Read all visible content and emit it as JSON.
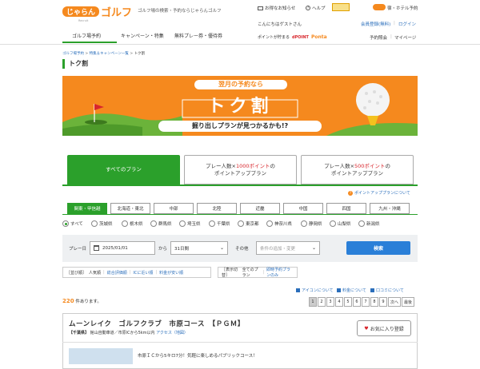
{
  "header": {
    "logo_text": "じゃらんゴルフ",
    "logo_sub": "Recruit",
    "tagline": "ゴルフ場の検索・予約ならじゃらんゴルフ",
    "mail": "お得なお知らせ",
    "help": "ヘルプ",
    "partner_text": "宿・ホテル予約",
    "greeting": "こんにちはゲストさん",
    "register": "会員登録(無料)",
    "login": "ログイン",
    "points_label": "ポイントが貯まる",
    "dpoint": "dPOINT",
    "ponta": "Ponta",
    "reservation": "予約照会",
    "mypage": "マイページ"
  },
  "nav": {
    "items": [
      {
        "label": "ゴルフ場予約"
      },
      {
        "label": "キャンペーン・特集"
      },
      {
        "label": "無料プレー券・優待券"
      }
    ]
  },
  "breadcrumb": [
    "ゴルフ場予約",
    "特集＆キャンペーン一覧",
    "トク割"
  ],
  "page_title": "トク割",
  "banner": {
    "line1": "翌月の予約なら",
    "line2": "トク割",
    "line3": "掘り出しプランが見つかるかも!?"
  },
  "plan_tabs": [
    {
      "label": "すべてのプラン"
    },
    {
      "pre": "プレー人数×",
      "pts": "1000ポイント",
      "post": "の",
      "line2": "ポイントアッププラン"
    },
    {
      "pre": "プレー人数×",
      "pts": "500ポイント",
      "post": "の",
      "line2": "ポイントアッププラン"
    }
  ],
  "point_up_about": "ポイントアッププランについて",
  "regions": [
    "関東・甲信越",
    "北海道・東北",
    "中部",
    "北陸",
    "近畿",
    "中国",
    "四国",
    "九州・沖縄"
  ],
  "prefectures": [
    "すべて",
    "茨城県",
    "栃木県",
    "群馬県",
    "埼玉県",
    "千葉県",
    "東京都",
    "神奈川県",
    "静岡県",
    "山梨県",
    "新潟県"
  ],
  "search": {
    "play_date_label": "プレー日",
    "date": "2025/01/01",
    "from": "から",
    "period": "31日間",
    "other_label": "その他",
    "condition_placeholder": "条件の追加・変更",
    "button": "検索"
  },
  "sort": {
    "label": "［並び順］",
    "current": "人気順",
    "options": [
      "総合評価順",
      "ICに近い順",
      "料金が安い順"
    ]
  },
  "display": {
    "label": "［表示切替］",
    "current": "全てのプラン",
    "option": "即時予約プランのみ"
  },
  "icon_links": [
    "アイコンについて",
    "料金について",
    "口コミについて"
  ],
  "results": {
    "count": "220",
    "suffix": "件あります。"
  },
  "pagination": [
    "1",
    "2",
    "3",
    "4",
    "5",
    "6",
    "7",
    "8",
    "9",
    "次へ",
    "最後"
  ],
  "course": {
    "name": "ムーンレイク　ゴルフクラブ　市原コース　【ＰＧＭ】",
    "pref": "【千葉県】",
    "access": "館山自動車道／市原ICから5km以内",
    "access_link": "アクセス（地図）",
    "fav": "お気に入り登録",
    "desc": "市原ＩＣから5キロ7分！気軽に楽しめるパブリックコース！"
  },
  "colors": {
    "brand_green": "#2ba02b",
    "brand_orange": "#f5891e",
    "link_blue": "#2a6ebb",
    "search_blue": "#2a7fd8",
    "point_red": "#d8262c"
  }
}
